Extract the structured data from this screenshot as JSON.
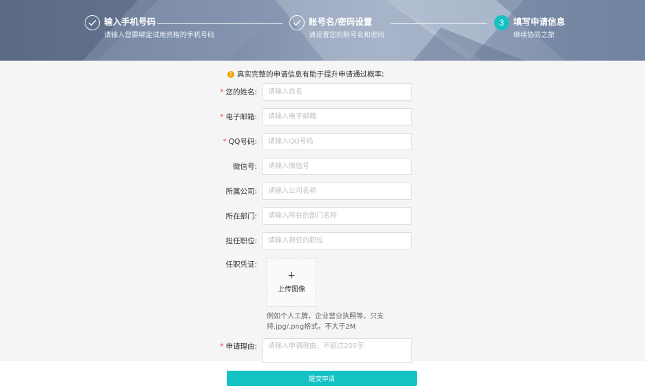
{
  "steps": [
    {
      "title": "输入手机号码",
      "subtitle": "请输入您要绑定试用资格的手机号码",
      "state": "done"
    },
    {
      "title": "账号名/密码设置",
      "subtitle": "请设置您的账号名和密码",
      "state": "done"
    },
    {
      "number": "3",
      "title": "填写申请信息",
      "subtitle": "继续协同之旅",
      "state": "active"
    }
  ],
  "notice": "真实完整的申请信息有助于提升申请通过概率;",
  "fields": {
    "name": {
      "label": "您的姓名:",
      "placeholder": "请输入姓名",
      "required": true
    },
    "email": {
      "label": "电子邮箱:",
      "placeholder": "请输入电子邮箱",
      "required": true
    },
    "qq": {
      "label": "QQ号码:",
      "placeholder": "请输入QQ号码",
      "required": true
    },
    "wechat": {
      "label": "微信号:",
      "placeholder": "请输入微信号",
      "required": false
    },
    "company": {
      "label": "所属公司:",
      "placeholder": "请输入公司名称",
      "required": false
    },
    "department": {
      "label": "所在部门:",
      "placeholder": "请输入所在的部门名称",
      "required": false
    },
    "position": {
      "label": "担任职位:",
      "placeholder": "请输入担任的职位",
      "required": false
    },
    "credential": {
      "label": "任职凭证:",
      "upload_plus": "+",
      "upload_label": "上传图像",
      "hint": "例如个人工牌，企业营业执照等，只支持.jpg/.png格式，不大于2M"
    },
    "reason": {
      "label": "申请理由:",
      "placeholder": "请输入申请理由，不超过200字",
      "required": true
    }
  },
  "required_mark": "*",
  "notice_icon": "!",
  "submit_label": "提交申请",
  "colors": {
    "accent": "#14c2c3",
    "required": "#e84c3d",
    "warning": "#f0a500"
  }
}
